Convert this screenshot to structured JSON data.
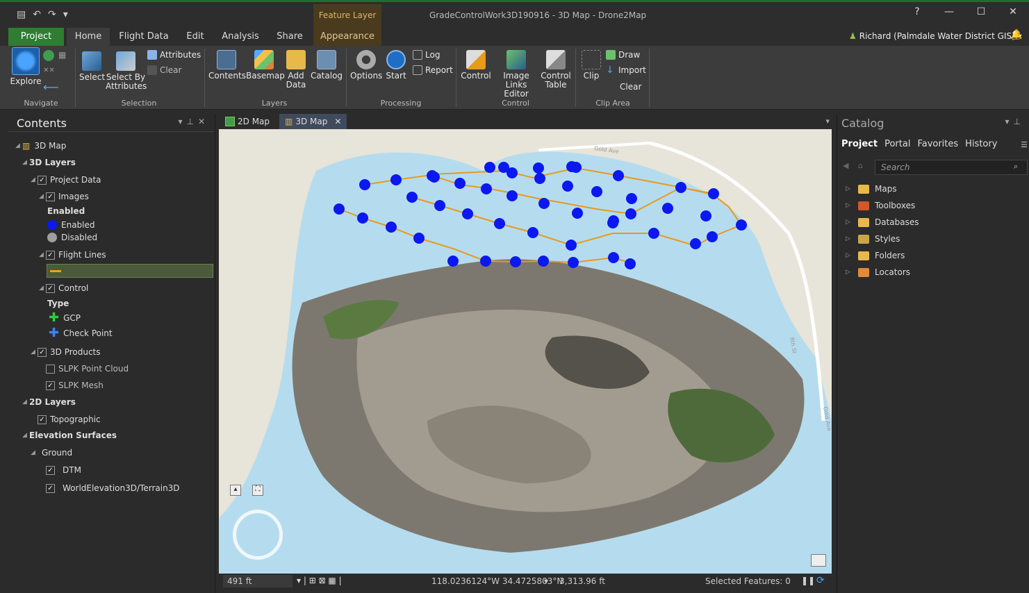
{
  "titlebar": {
    "contextual_tab": "Feature Layer",
    "title": "GradeControlWork3D190916 - 3D Map - Drone2Map",
    "help": "?",
    "minimize": "—",
    "maximize": "☐",
    "close": "✕"
  },
  "tabs": {
    "project": "Project",
    "home": "Home",
    "flight_data": "Flight Data",
    "edit": "Edit",
    "analysis": "Analysis",
    "share": "Share",
    "appearance": "Appearance",
    "user": "Richard (Palmdale Water District GIS) ▾"
  },
  "ribbon": {
    "explore": "Explore",
    "select": "Select",
    "select_by_attributes_1": "Select By",
    "select_by_attributes_2": "Attributes",
    "attributes": "Attributes",
    "clear": "Clear",
    "contents": "Contents",
    "basemap": "Basemap",
    "add_data_1": "Add",
    "add_data_2": "Data",
    "catalog": "Catalog",
    "options": "Options",
    "start": "Start",
    "log": "Log",
    "report": "Report",
    "control": "Control",
    "image_links_1": "Image",
    "image_links_2": "Links Editor",
    "control_table_1": "Control",
    "control_table_2": "Table",
    "clip": "Clip",
    "draw": "Draw",
    "import": "Import",
    "clip_clear": "Clear",
    "groups": {
      "navigate": "Navigate",
      "selection": "Selection",
      "layers": "Layers",
      "processing": "Processing",
      "control": "Control",
      "clip_area": "Clip Area"
    }
  },
  "contents": {
    "title": "Contents",
    "items": {
      "map3d": "3D Map",
      "layers3d": "3D Layers",
      "project_data": "Project Data",
      "images": "Images",
      "enabled_heading": "Enabled",
      "enabled": "Enabled",
      "disabled": "Disabled",
      "flight_lines": "Flight Lines",
      "control": "Control",
      "type_heading": "Type",
      "gcp": "GCP",
      "check_point": "Check Point",
      "products3d": "3D Products",
      "slpk_point_cloud": "SLPK Point Cloud",
      "slpk_mesh": "SLPK Mesh",
      "layers2d": "2D Layers",
      "topographic": "Topographic",
      "elevation_surfaces": "Elevation Surfaces",
      "ground": "Ground",
      "dtm": "DTM",
      "world_elevation": "WorldElevation3D/Terrain3D"
    }
  },
  "map_tabs": {
    "map2d": "2D Map",
    "map3d": "3D Map"
  },
  "map": {
    "road_labels": [
      "Gold Ave",
      "8th St",
      "Gold Ave"
    ],
    "flight_points_color": "#0b18f0",
    "flight_line_color": "#e89a1a"
  },
  "status": {
    "scale": "491 ft",
    "coords": "118.0236124°W 34.4725803°N",
    "distance": "3,313.96 ft",
    "selected": "Selected Features: 0"
  },
  "catalog": {
    "title": "Catalog",
    "tabs": [
      "Project",
      "Portal",
      "Favorites",
      "History"
    ],
    "search_placeholder": "Search",
    "items": [
      "Maps",
      "Toolboxes",
      "Databases",
      "Styles",
      "Folders",
      "Locators"
    ]
  },
  "colors": {
    "project_green": "#2e7d32",
    "contextual": "#4a3a1e",
    "enabled_dot": "#0b18f0",
    "disabled_dot": "#9e9e9e",
    "gcp_plus": "#2ecc40",
    "checkpoint_plus": "#3b82f6"
  }
}
